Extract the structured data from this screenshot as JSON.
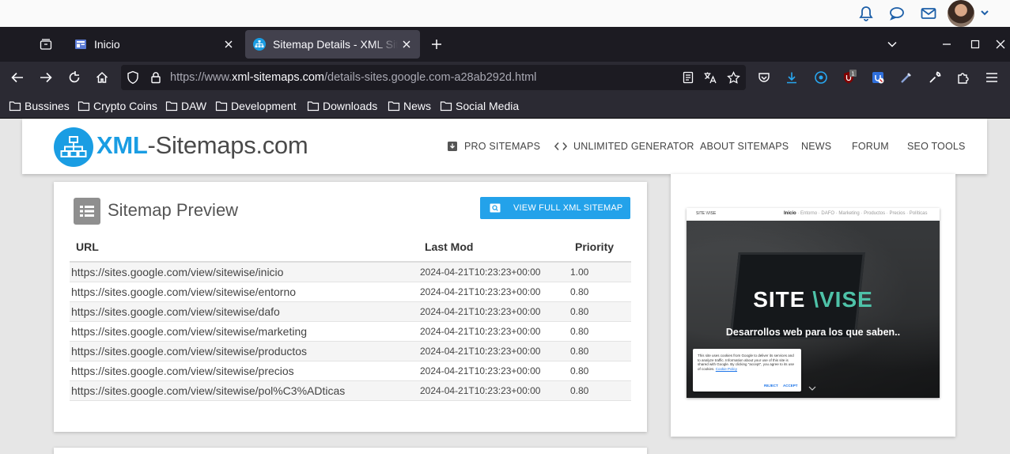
{
  "os_bar": {
    "icons": [
      "bell-icon",
      "chat-bubble-icon",
      "mail-icon",
      "avatar",
      "chevron-down-icon"
    ]
  },
  "browser": {
    "tabs": [
      {
        "title": "Inicio",
        "favicon": "google-sites-icon",
        "active": false
      },
      {
        "title": "Sitemap Details - XML Sitemaps",
        "favicon": "xml-sitemaps-icon",
        "active": true
      }
    ],
    "url": {
      "prefix": "https://www.",
      "host": "xml-sitemaps.com",
      "path": "/details-sites.google.com-a28ab292d.html"
    },
    "extension_badge": "1",
    "bookmarks": [
      "Bussines",
      "Crypto Coins",
      "DAW",
      "Development",
      "Downloads",
      "News",
      "Social Media"
    ]
  },
  "site": {
    "logo_xml": "XML",
    "logo_rest": "-Sitemaps.com",
    "menu": {
      "pro": "PRO SITEMAPS",
      "unlimited": "UNLIMITED GENERATOR",
      "about": "ABOUT SITEMAPS",
      "news": "NEWS",
      "forum": "FORUM",
      "seo": "SEO TOOLS"
    },
    "accent": "#1a9de3"
  },
  "preview": {
    "title": "Sitemap Preview",
    "button": "VIEW FULL XML SITEMAP",
    "columns": {
      "url": "URL",
      "lastmod": "Last Mod",
      "priority": "Priority"
    },
    "rows": [
      {
        "url": "https://sites.google.com/view/sitewise/inicio",
        "lastmod": "2024-04-21T10:23:23+00:00",
        "priority": "1.00"
      },
      {
        "url": "https://sites.google.com/view/sitewise/entorno",
        "lastmod": "2024-04-21T10:23:23+00:00",
        "priority": "0.80"
      },
      {
        "url": "https://sites.google.com/view/sitewise/dafo",
        "lastmod": "2024-04-21T10:23:23+00:00",
        "priority": "0.80"
      },
      {
        "url": "https://sites.google.com/view/sitewise/marketing",
        "lastmod": "2024-04-21T10:23:23+00:00",
        "priority": "0.80"
      },
      {
        "url": "https://sites.google.com/view/sitewise/productos",
        "lastmod": "2024-04-21T10:23:23+00:00",
        "priority": "0.80"
      },
      {
        "url": "https://sites.google.com/view/sitewise/precios",
        "lastmod": "2024-04-21T10:23:23+00:00",
        "priority": "0.80"
      },
      {
        "url": "https://sites.google.com/view/sitewise/pol%C3%ADticas",
        "lastmod": "2024-04-21T10:23:23+00:00",
        "priority": "0.80"
      }
    ]
  },
  "thumbnail": {
    "brand": "SITE \\VISE",
    "nav_links": [
      "Inicio",
      "Entorno",
      "DAFO",
      "Marketing",
      "Productos",
      "Precios",
      "Políticas"
    ],
    "hero_white": "SITE ",
    "hero_accent": "\\VISE",
    "subtitle": "Desarrollos web para los que saben..",
    "cookie_text": "This site uses cookies from Google to deliver its services and to analyze traffic. Information about your use of this site is shared with Google. By clicking \"accept\", you agree to its use of cookies.",
    "cookie_policy": "Cookie Policy",
    "reject": "REJECT",
    "accept": "ACCEPT"
  }
}
